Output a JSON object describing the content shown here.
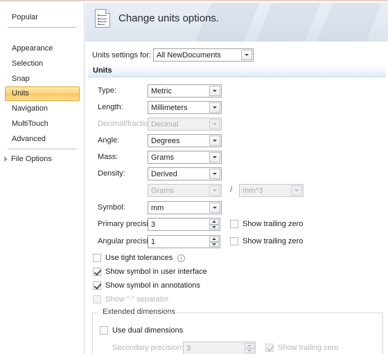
{
  "sidebar": {
    "top_item": {
      "label": "Popular"
    },
    "items": [
      {
        "label": "Appearance",
        "selected": false
      },
      {
        "label": "Selection",
        "selected": false
      },
      {
        "label": "Snap",
        "selected": false
      },
      {
        "label": "Units",
        "selected": true
      },
      {
        "label": "Navigation",
        "selected": false
      },
      {
        "label": "MultiTouch",
        "selected": false
      },
      {
        "label": "Advanced",
        "selected": false
      }
    ],
    "file_options": {
      "label": "File Options",
      "expander_icon": "triangle-right-icon"
    }
  },
  "header": {
    "title": "Change units options.",
    "icon": "document-lines-icon"
  },
  "settings_for": {
    "label": "Units settings for:",
    "value": "All NewDocuments"
  },
  "section": {
    "title": "Units"
  },
  "fields": {
    "type": {
      "label": "Type:",
      "value": "Metric",
      "disabled": false
    },
    "length": {
      "label": "Length:",
      "value": "Millimeters",
      "disabled": false
    },
    "decimal_fraction": {
      "label": "Decimal/fraction:",
      "value": "Decimal",
      "disabled": true
    },
    "angle": {
      "label": "Angle:",
      "value": "Degrees",
      "disabled": false
    },
    "mass": {
      "label": "Mass:",
      "value": "Grams",
      "disabled": false
    },
    "density": {
      "label": "Density:",
      "value": "Derived",
      "disabled": false
    },
    "density_numerator": {
      "value": "Grams",
      "disabled": true
    },
    "density_separator": "/",
    "density_denominator": {
      "value": "mm^3",
      "disabled": true
    },
    "symbol": {
      "label": "Symbol:",
      "value": "mm",
      "disabled": false
    },
    "primary_precision": {
      "label": "Primary precision:",
      "value": "3",
      "disabled": false
    },
    "angular_precision": {
      "label": "Angular precision:",
      "value": "1",
      "disabled": false
    }
  },
  "checkboxes": {
    "primary_trailing_zero": {
      "label": "Show trailing zero",
      "checked": false,
      "disabled": false
    },
    "angular_trailing_zero": {
      "label": "Show trailing zero",
      "checked": false,
      "disabled": false
    },
    "tight_tolerances": {
      "label": "Use tight tolerances",
      "checked": false,
      "disabled": false,
      "info_icon": "info-circle-icon"
    },
    "symbol_ui": {
      "label": "Show symbol in user interface",
      "checked": true,
      "disabled": false
    },
    "symbol_annotations": {
      "label": "Show symbol in annotations",
      "checked": true,
      "disabled": false
    },
    "dash_separator": {
      "label": "Show \"-\" separator",
      "checked": false,
      "disabled": true
    }
  },
  "extended_dimensions": {
    "title": "Extended dimensions",
    "use_dual": {
      "label": "Use dual dimensions",
      "checked": false,
      "disabled": false
    },
    "secondary_precision": {
      "label": "Secondary precision:",
      "value": "3",
      "disabled": true
    },
    "secondary_trailing_zero": {
      "label": "Show trailing zero",
      "checked": true,
      "disabled": true
    }
  },
  "colors": {
    "selected_item_border": "#e0a92c",
    "selected_item_fill": "#fbd583",
    "header_bg": "#e4eaf2",
    "top_border": "#e8cfc8",
    "section_bar": "#dfeaf6"
  }
}
